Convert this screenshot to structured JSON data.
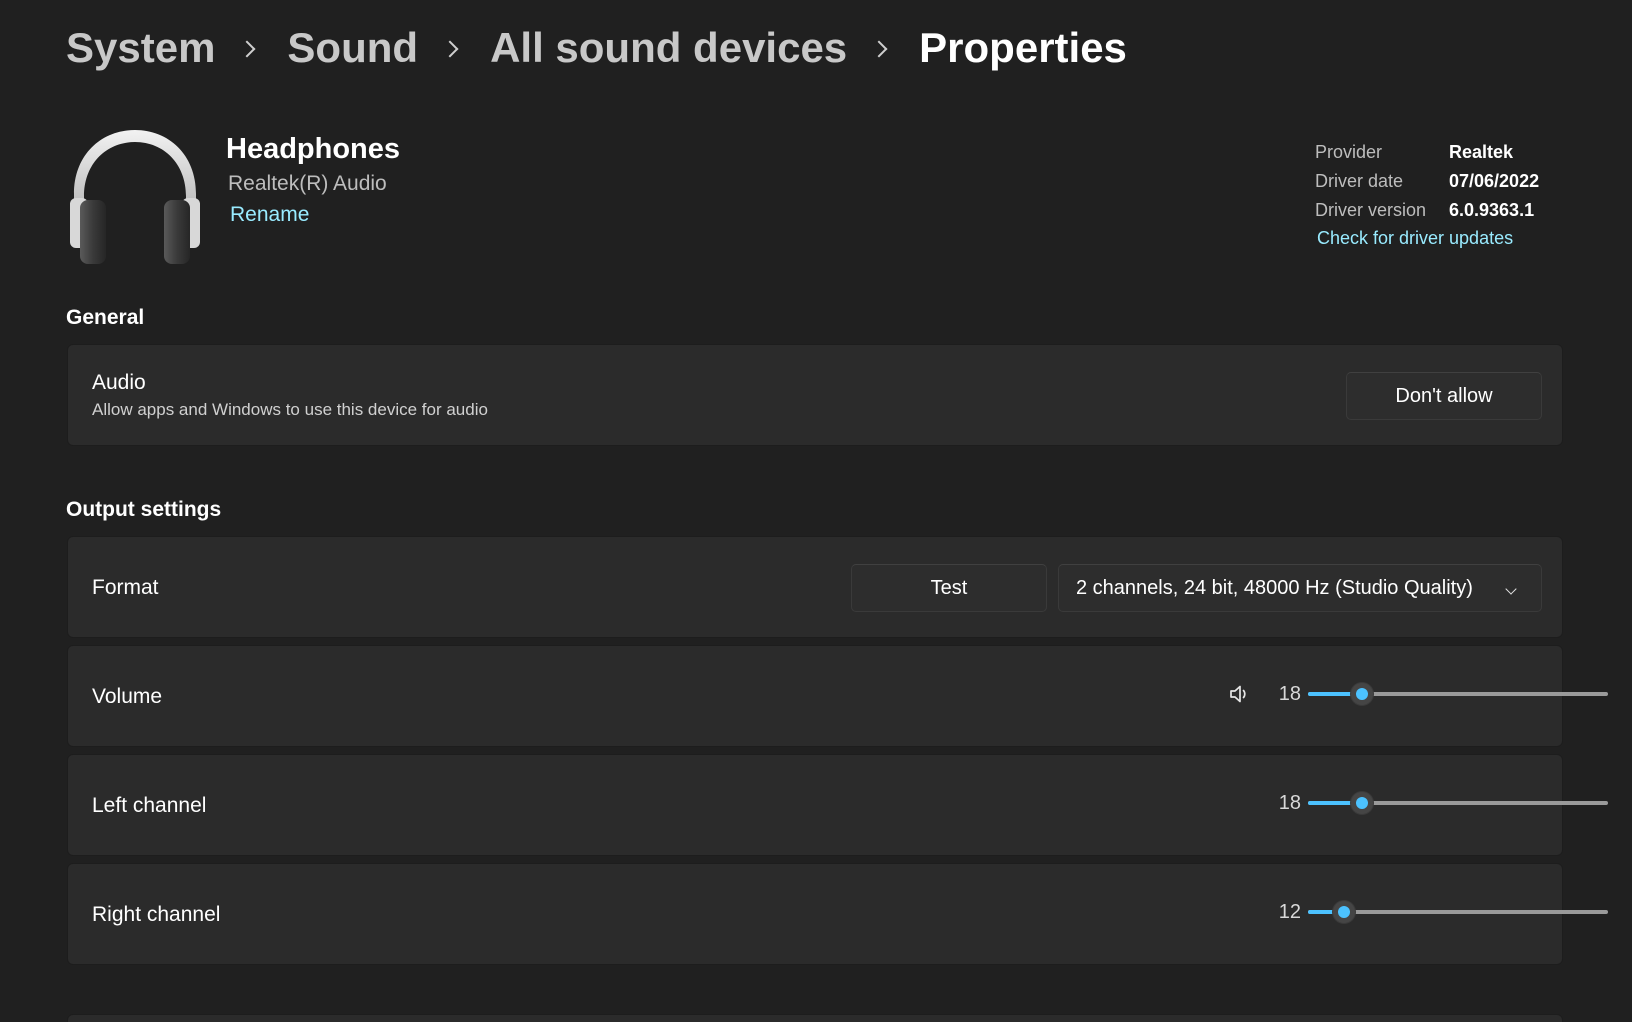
{
  "breadcrumb": {
    "items": [
      "System",
      "Sound",
      "All sound devices"
    ],
    "current": "Properties"
  },
  "device": {
    "icon": "headphones-icon",
    "name": "Headphones",
    "subtitle": "Realtek(R) Audio",
    "rename_label": "Rename"
  },
  "driver": {
    "rows": [
      {
        "label": "Provider",
        "value": "Realtek"
      },
      {
        "label": "Driver date",
        "value": "07/06/2022"
      },
      {
        "label": "Driver version",
        "value": "6.0.9363.1"
      }
    ],
    "update_link": "Check for driver updates"
  },
  "general": {
    "title": "General",
    "audio": {
      "title": "Audio",
      "description": "Allow apps and Windows to use this device for audio",
      "button_label": "Don't allow"
    }
  },
  "output": {
    "title": "Output settings",
    "format": {
      "title": "Format",
      "test_label": "Test",
      "selected": "2 channels, 24 bit, 48000 Hz (Studio Quality)"
    },
    "volume": {
      "title": "Volume",
      "value": "18",
      "icon": "speaker-icon"
    },
    "left_channel": {
      "title": "Left channel",
      "value": "18"
    },
    "right_channel": {
      "title": "Right channel",
      "value": "12"
    }
  },
  "colors": {
    "background": "#202020",
    "card": "#2b2b2b",
    "accent": "#4cc2ff",
    "link": "#99ebff"
  }
}
